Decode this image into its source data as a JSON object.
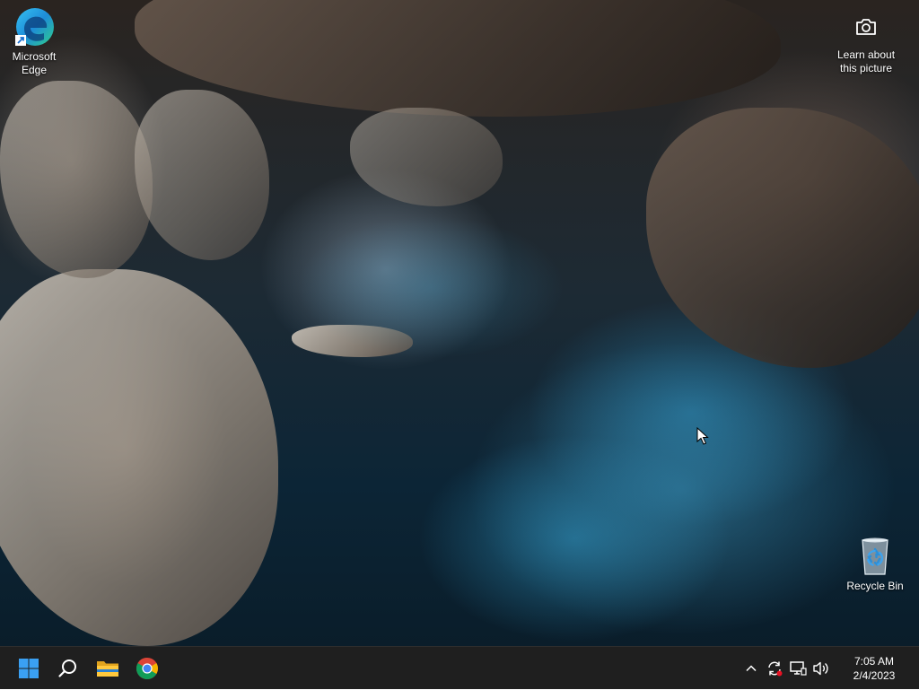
{
  "desktop": {
    "icons": [
      {
        "name": "Microsoft Edge",
        "label_lines": [
          "Microsoft",
          "Edge"
        ],
        "icon": "edge-icon"
      },
      {
        "name": "Recycle Bin",
        "label_lines": [
          "Recycle Bin"
        ],
        "icon": "recycle-bin-icon"
      }
    ],
    "spotlight": {
      "label_lines": [
        "Learn about",
        "this picture"
      ],
      "icon": "camera-icon"
    }
  },
  "taskbar": {
    "background": "#1f1f1f",
    "pinned": [
      {
        "name": "Start",
        "icon": "windows-logo-icon",
        "color": "#3aa0f3"
      },
      {
        "name": "Search",
        "icon": "search-icon"
      },
      {
        "name": "File Explorer",
        "icon": "folder-icon"
      },
      {
        "name": "Google Chrome",
        "icon": "chrome-icon"
      }
    ],
    "tray": {
      "icons": [
        "chevron-up-icon",
        "sync-icon",
        "network-icon",
        "volume-icon"
      ],
      "time": "7:05 AM",
      "date": "2/4/2023"
    }
  }
}
